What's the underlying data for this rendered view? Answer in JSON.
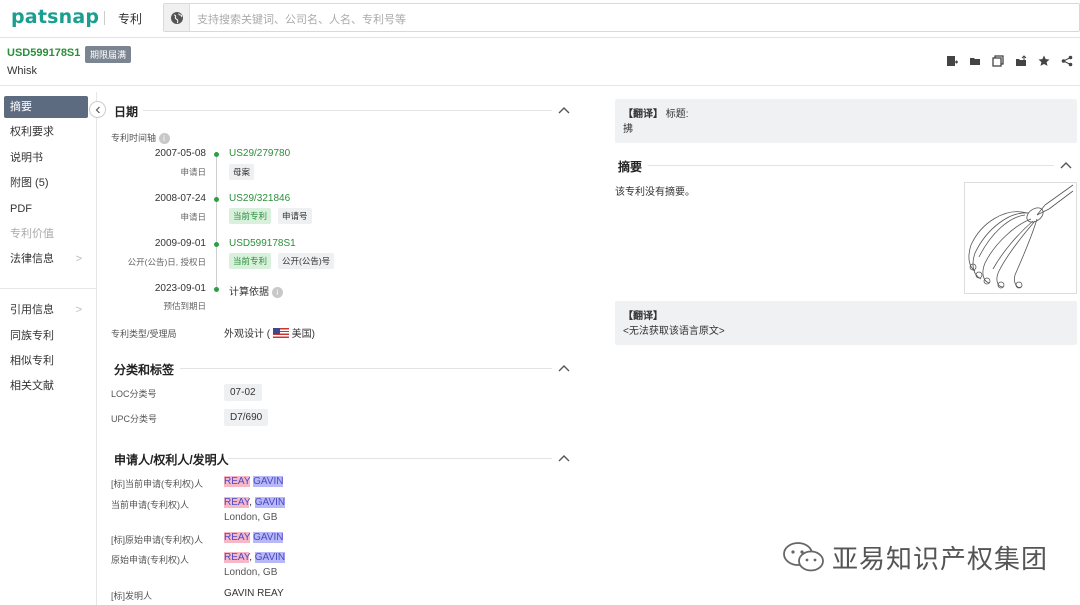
{
  "topbar": {
    "logo": "patsnap",
    "product": "专利",
    "search_placeholder": "支持搜索关键词、公司名、人名、专利号等"
  },
  "header": {
    "patent_number": "USD599178S1",
    "status_badge": "期限届满",
    "title": "Whisk"
  },
  "actions": [
    "add-note-icon",
    "folder-icon",
    "copy-icon",
    "share-folder-icon",
    "star-icon",
    "share-icon"
  ],
  "nav": {
    "items": [
      {
        "label": "摘要",
        "active": true
      },
      {
        "label": "权利要求"
      },
      {
        "label": "说明书"
      },
      {
        "label": "附图 (5)"
      },
      {
        "label": "PDF"
      },
      {
        "label": "专利价值",
        "disabled": true
      },
      {
        "label": "法律信息",
        "chevron": ">"
      },
      {
        "label": "引用信息",
        "chevron": ">"
      },
      {
        "label": "同族专利"
      },
      {
        "label": "相似专利"
      },
      {
        "label": "相关文献"
      }
    ]
  },
  "dates": {
    "heading": "日期",
    "timeline_label": "专利时间轴",
    "events": [
      {
        "date": "2007-05-08",
        "label": "申请日",
        "number": "US29/279780",
        "tags": [
          "母案"
        ]
      },
      {
        "date": "2008-07-24",
        "label": "申请日",
        "number": "US29/321846",
        "tags": [
          "当前专利",
          "申请号"
        ]
      },
      {
        "date": "2009-09-01",
        "label": "公开(公告)日, 授权日",
        "number": "USD599178S1",
        "tags": [
          "当前专利",
          "公开(公告)号"
        ]
      },
      {
        "date": "2023-09-01",
        "label": "预估到期日",
        "number": "计算依据",
        "tags": []
      }
    ],
    "type_label": "专利类型/受理局",
    "type_value": "外观设计 (",
    "country": "美国",
    "type_close": ")"
  },
  "classification": {
    "heading": "分类和标签",
    "loc_label": "LOC分类号",
    "loc_value": "07-02",
    "upc_label": "UPC分类号",
    "upc_value": "D7/690"
  },
  "applicants": {
    "heading": "申请人/权利人/发明人",
    "rows": [
      {
        "label": "[标]当前申请(专利权)人",
        "name1": "REAY",
        "sep": " ",
        "name2": "GAVIN",
        "sub": ""
      },
      {
        "label": "当前申请(专利权)人",
        "name1": "REAY",
        "sep": ", ",
        "name2": "GAVIN",
        "sub": "London, GB"
      },
      {
        "label": "[标]原始申请(专利权)人",
        "name1": "REAY",
        "sep": " ",
        "name2": "GAVIN",
        "sub": ""
      },
      {
        "label": "原始申请(专利权)人",
        "name1": "REAY",
        "sep": ", ",
        "name2": "GAVIN",
        "sub": "London, GB"
      }
    ],
    "inventor_label": "[标]发明人",
    "inventor_value": "GAVIN REAY"
  },
  "right": {
    "translate1_tag": "【翻译】",
    "translate1_label": "标题:",
    "translate1_text": "拂",
    "abstract_heading": "摘要",
    "abstract_text": "该专利没有摘要。",
    "translate2_tag": "【翻译】",
    "translate2_text": "<无法获取该语言原文>"
  },
  "watermark": "亚易知识产权集团",
  "colors": {
    "brand": "#1a9e8f",
    "green": "#2a8f3a",
    "nav_active": "#5c6b7f"
  }
}
